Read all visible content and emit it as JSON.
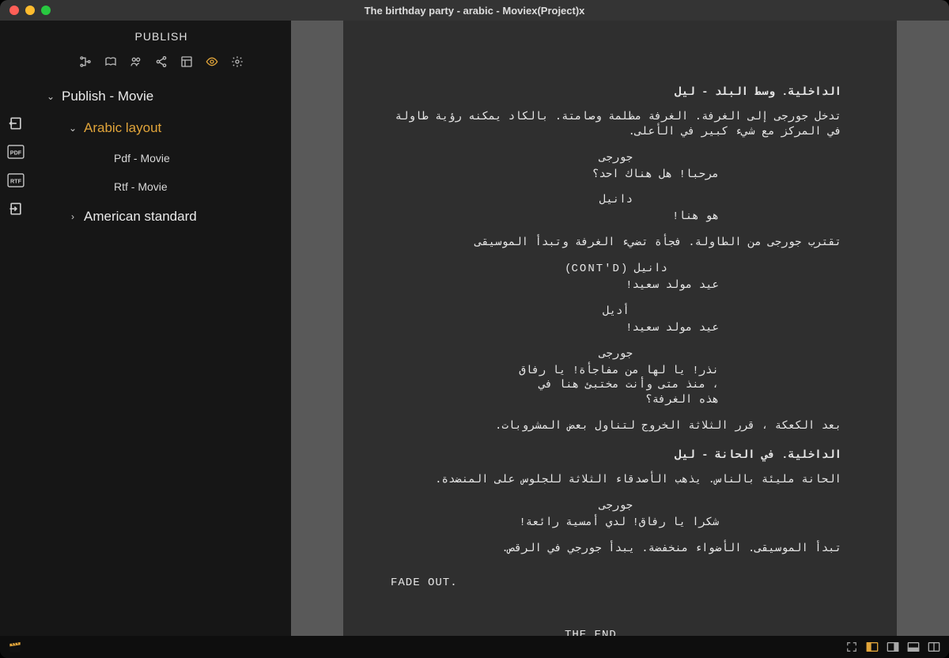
{
  "window": {
    "title": "The birthday party - arabic - Moviex(Project)x"
  },
  "sidebar": {
    "header": "PUBLISH",
    "tree": {
      "root": "Publish - Movie",
      "arabic": "Arabic layout",
      "pdf": "Pdf - Movie",
      "rtf": "Rtf - Movie",
      "american": "American standard"
    }
  },
  "script": {
    "scene1": "الداخلية. وسط البلد - ليل",
    "action1": "تدخل جورجى إلى الغرفة. الغرفة مظلمة وصامتة. بالكاد يمكنه رؤية طاولة في المركز مع شيء كبير في الأعلى.",
    "c_georgi": "جورجى",
    "d_georgi1": "مرحبا! هل هناك احد؟",
    "c_daniel": "دانيل",
    "d_daniel1": "هو هنا!",
    "action2": "تقترب جورجى من الطاولة. فجأة تضيء الغرفة وتبدأ الموسيقى",
    "c_daniel_contd": "دانيل (CONT'D)",
    "d_daniel2": "عيد مولد سعيد!",
    "c_adele": "أديل",
    "d_adele1": "عيد مولد سعيد!",
    "d_georgi2": "نذر! يا لها من مفاجأة! يا رفاق ، منذ متى وأنت مختبئ هنا في هذه الغرفة؟",
    "action3": "بعد الكعكة ، قرر الثلاثة الخروج لتناول بعض المشروبات.",
    "scene2": "الداخلية. في الحانة - ليل",
    "action4": "الحانة مليئة بالناس. يذهب الأصدقاء الثلاثة للجلوس على المنضدة.",
    "d_georgi3": "شكرا يا رفاق! لدي أمسية رائعة!",
    "action5": "تبدأ الموسيقى. الأضواء منخفضة. يبدأ جورجي في الرقص.",
    "fadeout": "FADE OUT.",
    "theend": "THE END"
  }
}
